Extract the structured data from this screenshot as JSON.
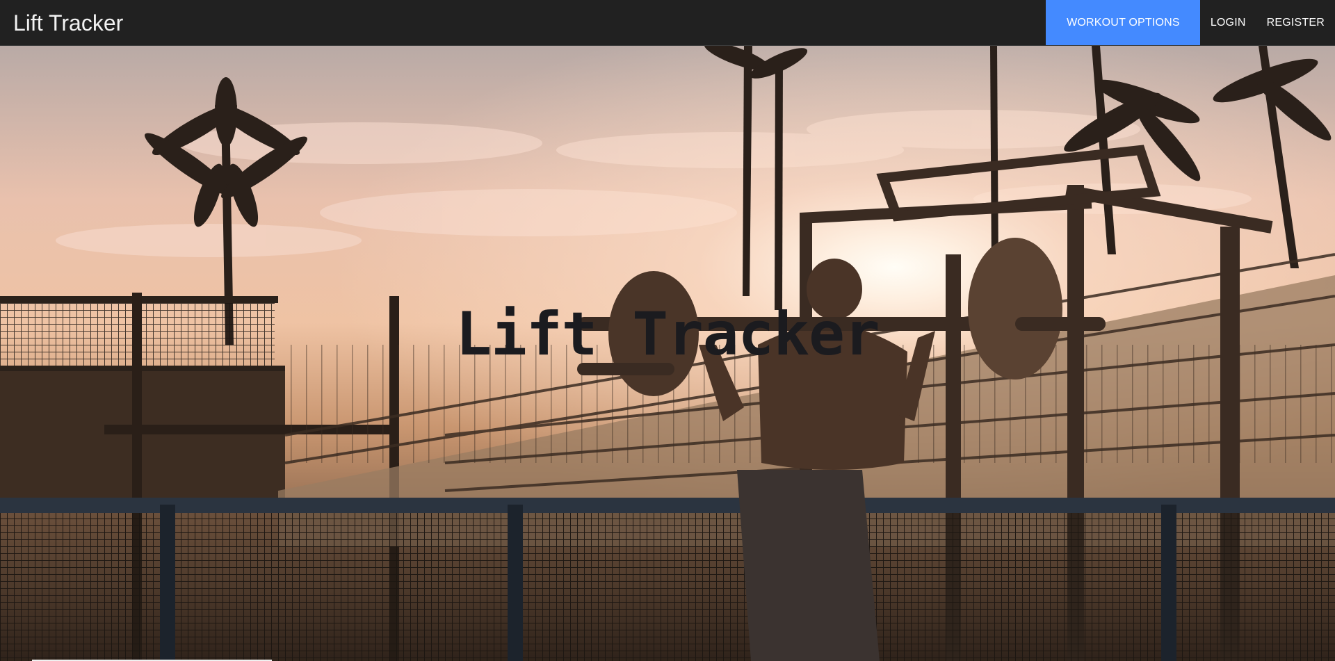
{
  "app": {
    "brand": "Lift Tracker"
  },
  "nav": {
    "items": [
      {
        "label": "WORKOUT OPTIONS",
        "active": true
      },
      {
        "label": "LOGIN",
        "active": false
      },
      {
        "label": "REGISTER",
        "active": false
      }
    ]
  },
  "hero": {
    "title": "Lift Tracker",
    "image_description_icon": "photo-background"
  },
  "colors": {
    "navbar_bg": "#212121",
    "accent": "#448aff",
    "title": "#1b1b1f"
  }
}
